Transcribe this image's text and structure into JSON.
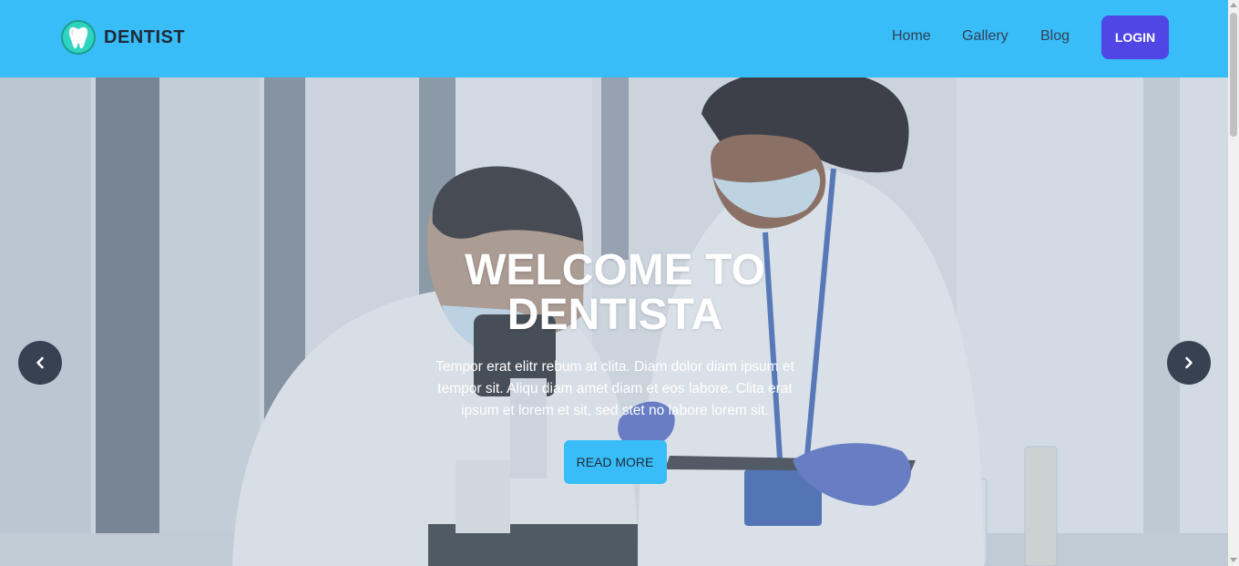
{
  "navbar": {
    "brand": "DENTIST",
    "brand_icon": "tooth-icon",
    "links": [
      "Home",
      "Gallery",
      "Blog"
    ],
    "login_label": "LOGIN"
  },
  "hero": {
    "title_line1": "WELCOME TO",
    "title_line2": "DENTISTA",
    "text": "Tempor erat elitr rebum at clita. Diam dolor diam ipsum et tempor sit. Aliqu diam amet diam et eos labore. Clita erat ipsum et lorem et sit, sed stet no labore lorem sit.",
    "button_label": "READ MORE",
    "prev_icon": "chevron-left-icon",
    "next_icon": "chevron-right-icon"
  },
  "colors": {
    "navbar": "#38bdf8",
    "login_button": "#4f46e5",
    "read_more_button": "#38bdf8",
    "carousel_arrow": "#374151"
  }
}
